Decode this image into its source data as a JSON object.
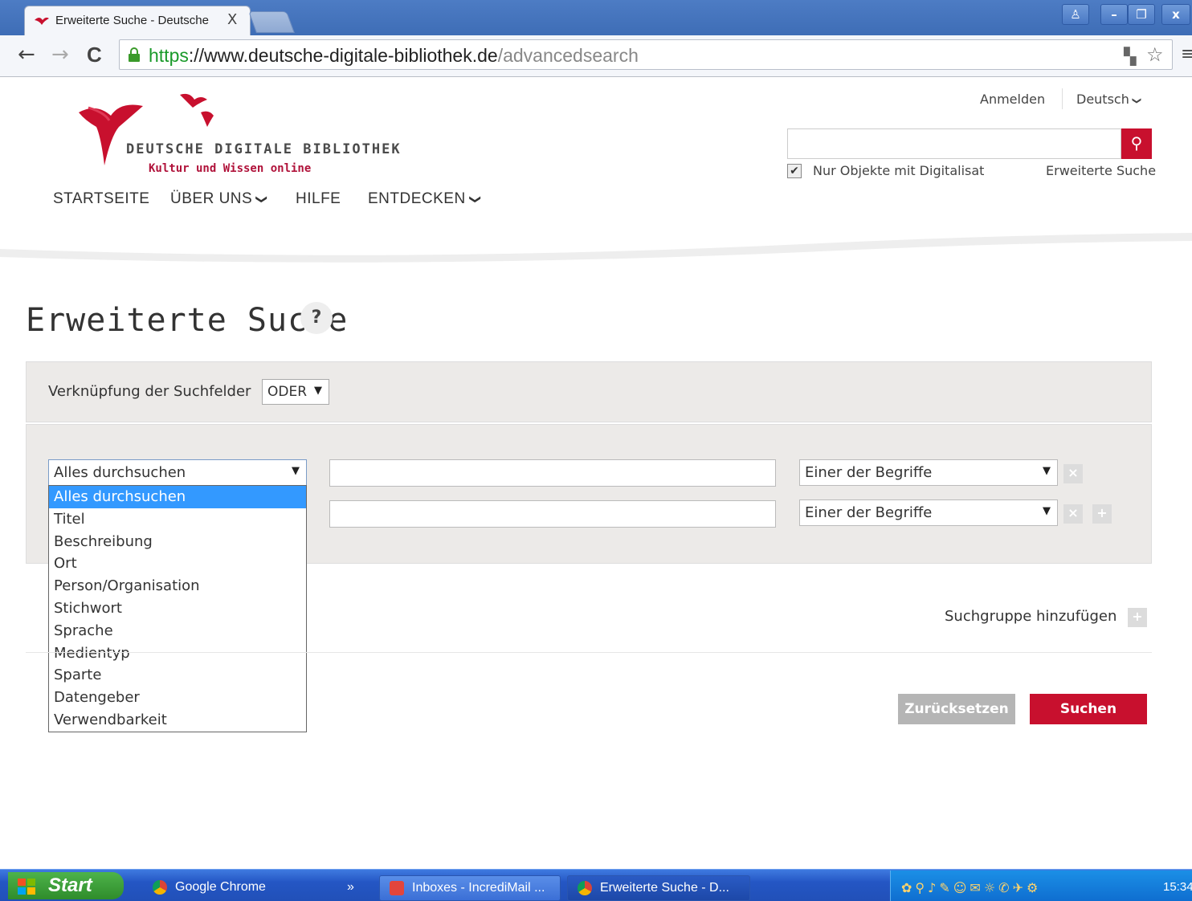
{
  "browser": {
    "tab_title": "Erweiterte Suche - Deutsche",
    "tab_close": "X",
    "url_scheme": "https",
    "url_host": "://www.deutsche-digitale-bibliothek.de",
    "url_path": "/advancedsearch",
    "back": "←",
    "forward": "→",
    "reload": "C",
    "translate_icon": "▚",
    "star_icon": "☆",
    "menu_icon": "≡"
  },
  "header": {
    "logo_title": "DEUTSCHE DIGITALE BIBLIOTHEK",
    "logo_subtitle": "Kultur und Wissen online",
    "login": "Anmelden",
    "language": "Deutsch",
    "search_button": "⚲",
    "only_digitized_label": "Nur Objekte mit Digitalisat",
    "only_digitized_checked": "✔",
    "advanced_search_link": "Erweiterte Suche",
    "brand_color": "#c8102e"
  },
  "nav": {
    "home": "STARTSEITE",
    "about": "ÜBER UNS",
    "help": "HILFE",
    "discover": "ENTDECKEN",
    "chevron": "❯"
  },
  "main": {
    "title": "Erweiterte Suche",
    "help_icon": "?",
    "link_label": "Verknüpfung der Suchfelder",
    "link_value": "ODER",
    "rows": [
      {
        "field": "Alles durchsuchen",
        "operator": "Einer der Begriffe"
      },
      {
        "field": "Alles durchsuchen",
        "operator": "Einer der Begriffe"
      }
    ],
    "remove_icon": "×",
    "add_icon": "+",
    "dropdown_options": [
      "Alles durchsuchen",
      "Titel",
      "Beschreibung",
      "Ort",
      "Person/Organisation",
      "Stichwort",
      "Sprache",
      "Medientyp",
      "Sparte",
      "Datengeber",
      "Verwendbarkeit"
    ],
    "add_group": "Suchgruppe hinzufügen",
    "reset": "Zurücksetzen",
    "search": "Suchen"
  },
  "taskbar": {
    "start": "Start",
    "items": [
      "Google Chrome",
      "Inboxes - IncrediMail ...",
      "Erweiterte Suche - D..."
    ],
    "more": "»",
    "tray_icons": "✿⚲♪✎☺✉☼✆✈⚙",
    "clock": "15:34"
  }
}
